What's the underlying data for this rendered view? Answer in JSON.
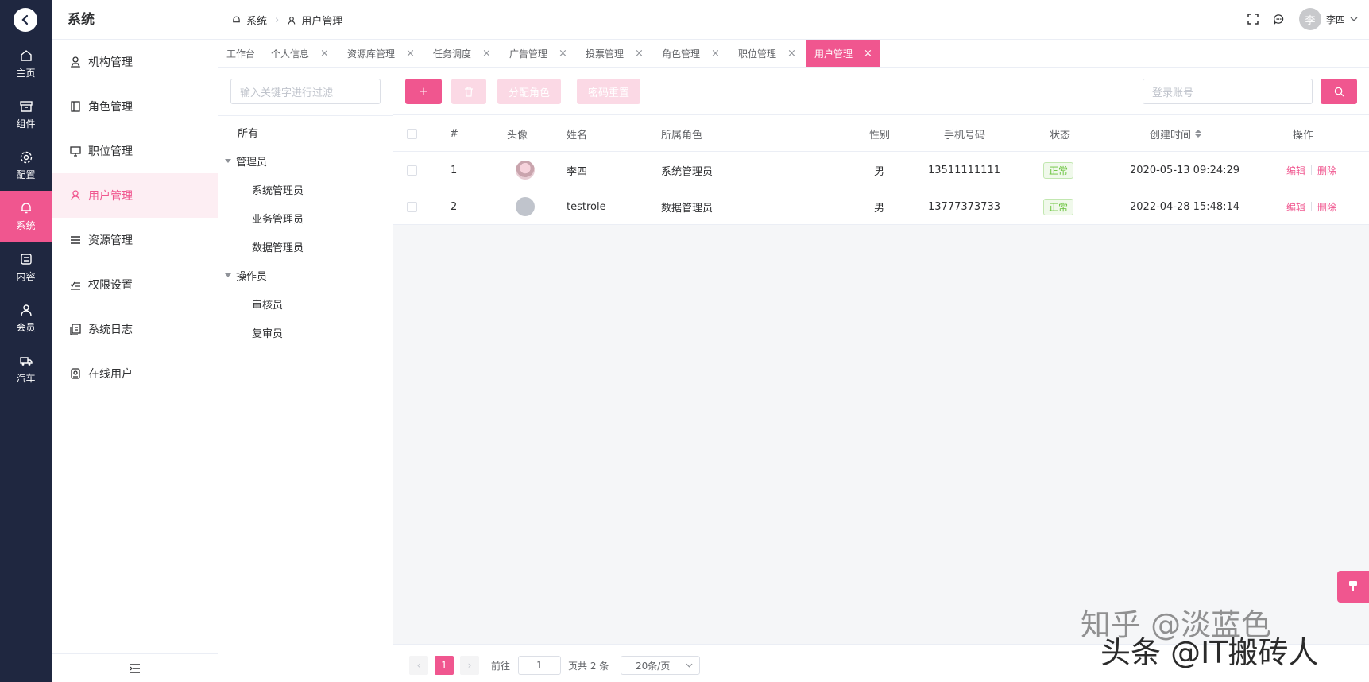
{
  "rail": {
    "items": [
      {
        "label": "主页",
        "icon": "home-icon"
      },
      {
        "label": "组件",
        "icon": "box-icon"
      },
      {
        "label": "配置",
        "icon": "gear-icon"
      },
      {
        "label": "系统",
        "icon": "bell-icon",
        "active": true
      },
      {
        "label": "内容",
        "icon": "content-icon"
      },
      {
        "label": "会员",
        "icon": "user-icon"
      },
      {
        "label": "汽车",
        "icon": "truck-icon"
      }
    ]
  },
  "submenu": {
    "title": "系统",
    "items": [
      {
        "label": "机构管理"
      },
      {
        "label": "角色管理"
      },
      {
        "label": "职位管理"
      },
      {
        "label": "用户管理",
        "active": true
      },
      {
        "label": "资源管理"
      },
      {
        "label": "权限设置"
      },
      {
        "label": "系统日志"
      },
      {
        "label": "在线用户"
      }
    ]
  },
  "breadcrumb": {
    "root": "系统",
    "current": "用户管理"
  },
  "header": {
    "user": "李四",
    "avatar_char": "李"
  },
  "tabs": [
    {
      "label": "工作台",
      "closable": false
    },
    {
      "label": "个人信息",
      "closable": true
    },
    {
      "label": "资源库管理",
      "closable": true
    },
    {
      "label": "任务调度",
      "closable": true
    },
    {
      "label": "广告管理",
      "closable": true
    },
    {
      "label": "投票管理",
      "closable": true
    },
    {
      "label": "角色管理",
      "closable": true
    },
    {
      "label": "职位管理",
      "closable": true
    },
    {
      "label": "用户管理",
      "closable": true,
      "active": true
    }
  ],
  "tree": {
    "filter_placeholder": "输入关键字进行过滤",
    "all": "所有",
    "groups": [
      {
        "label": "管理员",
        "children": [
          "系统管理员",
          "业务管理员",
          "数据管理员"
        ]
      },
      {
        "label": "操作员",
        "children": [
          "审核员",
          "复审员"
        ]
      }
    ]
  },
  "toolbar": {
    "add": "+",
    "assign_role": "分配角色",
    "reset_password": "密码重置",
    "search_placeholder": "登录账号"
  },
  "table": {
    "headers": {
      "index": "#",
      "avatar": "头像",
      "name": "姓名",
      "role": "所属角色",
      "gender": "性别",
      "phone": "手机号码",
      "status": "状态",
      "created": "创建时间",
      "actions": "操作"
    },
    "rows": [
      {
        "index": "1",
        "name": "李四",
        "role": "系统管理员",
        "gender": "男",
        "phone": "13511111111",
        "status": "正常",
        "created": "2020-05-13 09:24:29",
        "edit": "编辑",
        "delete": "删除"
      },
      {
        "index": "2",
        "name": "testrole",
        "role": "数据管理员",
        "gender": "男",
        "phone": "13777373733",
        "status": "正常",
        "created": "2022-04-28 15:48:14",
        "edit": "编辑",
        "delete": "删除"
      }
    ]
  },
  "pager": {
    "current": "1",
    "goto_label": "前往",
    "goto_value": "1",
    "total_label": "页共 2 条",
    "page_size": "20条/页"
  },
  "watermark": {
    "line1": "知乎 @淡蓝色",
    "line2": "头条 @IT搬砖人"
  },
  "colors": {
    "accent": "#f0568f",
    "rail": "#1f2740"
  }
}
